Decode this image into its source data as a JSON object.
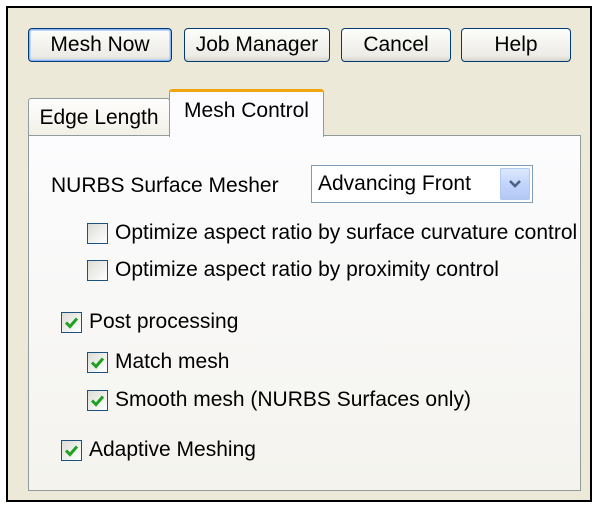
{
  "buttons": {
    "mesh_now": "Mesh Now",
    "job_manager": "Job Manager",
    "cancel": "Cancel",
    "help": "Help"
  },
  "tabs": [
    {
      "label": "Edge Length",
      "active": false
    },
    {
      "label": "Mesh Control",
      "active": true
    }
  ],
  "mesh_control": {
    "nurbs_label": "NURBS Surface Mesher",
    "nurbs_value": "Advancing Front",
    "options": [
      {
        "label": "Optimize aspect ratio by surface curvature control",
        "checked": false
      },
      {
        "label": "Optimize aspect ratio by proximity control",
        "checked": false
      },
      {
        "label": "Post processing",
        "checked": true
      },
      {
        "label": "Match mesh",
        "checked": true
      },
      {
        "label": "Smooth mesh (NURBS Surfaces only)",
        "checked": true
      },
      {
        "label": "Adaptive Meshing",
        "checked": true
      }
    ]
  },
  "colors": {
    "check": "#21a121",
    "dialog_bg": "#ece9d8",
    "active_tab_accent": "#f0a70f",
    "button_border": "#003c74"
  }
}
